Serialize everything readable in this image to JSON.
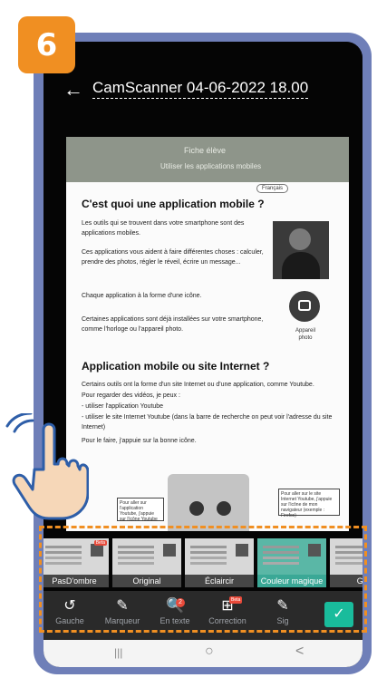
{
  "step": {
    "number": "6"
  },
  "header": {
    "back_icon": "←",
    "title": "CamScanner 04-06-2022 18.00"
  },
  "document": {
    "banner_line1": "Fiche élève",
    "banner_line2": "Utiliser les applications mobiles",
    "language": "Français",
    "heading1": "C'est quoi une application mobile ?",
    "para1": "Les outils qui se trouvent dans votre smartphone sont des applications mobiles.",
    "para2": "Ces applications vous aident à faire différentes choses : calculer, prendre des photos, régler le réveil, écrire un message...",
    "para3": "Chaque application à la forme d'une icône.",
    "para4": "Certaines applications sont déjà installées sur votre smartphone, comme l'horloge ou l'appareil photo.",
    "camera_label": "Appareil photo",
    "heading2": "Application mobile ou site Internet ?",
    "para5": "Certains outils ont la forme d'un site Internet ou d'une application, comme Youtube.",
    "para6": "Pour regarder des vidéos, je peux :",
    "bullet1": "-   utiliser l'application Youtube",
    "bullet2": "-   utiliser le site Internet Youtube (dans la barre de recherche on peut voir l'adresse du site Internet)",
    "para7": "Pour le faire, j'appuie sur la bonne icône.",
    "box_left": "Pour aller sur l'application Youtube, j'appuie sur l'icône Youtube",
    "box_right": "Pour aller sur le site Internet Youtube, j'appuie sur l'icône de mon navigateur (exemple : Firefox)"
  },
  "filters": [
    {
      "label": "PasD'ombre",
      "beta": "Beta",
      "active": false
    },
    {
      "label": "Original",
      "beta": "",
      "active": false
    },
    {
      "label": "Éclaircir",
      "beta": "",
      "active": false
    },
    {
      "label": "Couleur magique",
      "beta": "",
      "active": true
    },
    {
      "label": "Gris",
      "beta": "",
      "active": false
    }
  ],
  "tools": [
    {
      "icon": "↺",
      "label": "Gauche"
    },
    {
      "icon": "✎",
      "label": "Marqueur"
    },
    {
      "icon": "🔍",
      "label": "En texte",
      "badge": "2"
    },
    {
      "icon": "⊞",
      "label": "Correction",
      "beta": "Beta"
    },
    {
      "icon": "✎",
      "label": "Sig"
    }
  ],
  "confirm_icon": "✓",
  "navbar": {
    "recent": "|||",
    "home": "○",
    "back": "<"
  },
  "colors": {
    "accent": "#f08f22",
    "frame": "#6f7fb8",
    "active_filter": "#3aa896",
    "confirm": "#19bc9c"
  }
}
